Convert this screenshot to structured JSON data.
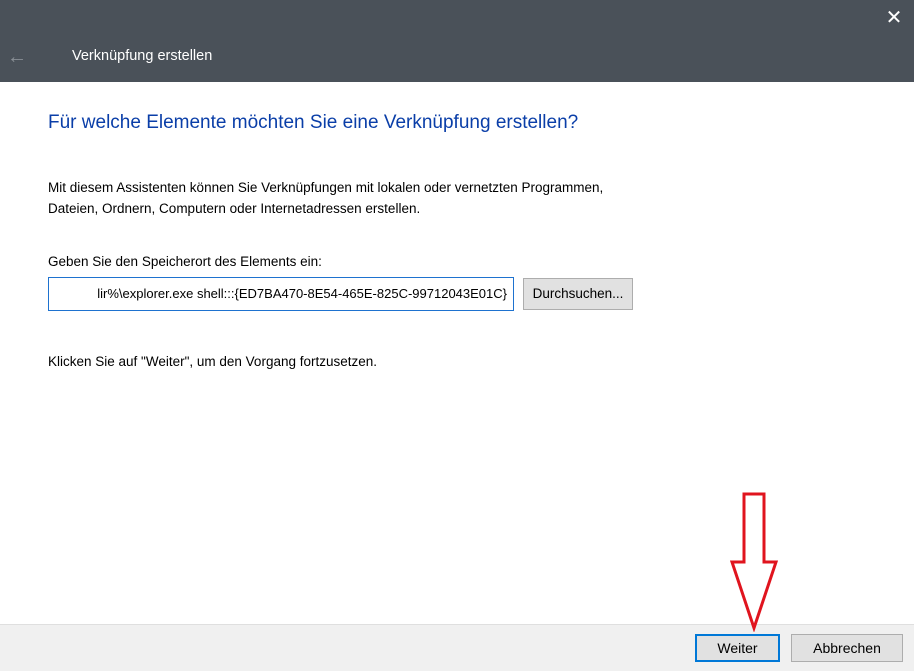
{
  "window": {
    "title": "Verknüpfung erstellen",
    "back_icon": "arrow-left-icon",
    "close_icon": "close-icon"
  },
  "main": {
    "heading": "Für welche Elemente möchten Sie eine Verknüpfung erstellen?",
    "description": "Mit diesem Assistenten können Sie Verknüpfungen mit lokalen oder vernetzten Programmen,\nDateien, Ordnern, Computern oder Internetadressen erstellen.",
    "location_label": "Geben Sie den Speicherort des Elements ein:",
    "location_value": "lir%\\explorer.exe shell:::{ED7BA470-8E54-465E-825C-99712043E01C}",
    "browse_label": "Durchsuchen...",
    "hint": "Klicken Sie auf \"Weiter\", um den Vorgang fortzusetzen."
  },
  "footer": {
    "next_label": "Weiter",
    "cancel_label": "Abbrechen"
  },
  "colors": {
    "titlebar": "#4a5159",
    "heading": "#0a3ea8",
    "accent": "#0078d7",
    "annotation_arrow": "#e0141e"
  }
}
